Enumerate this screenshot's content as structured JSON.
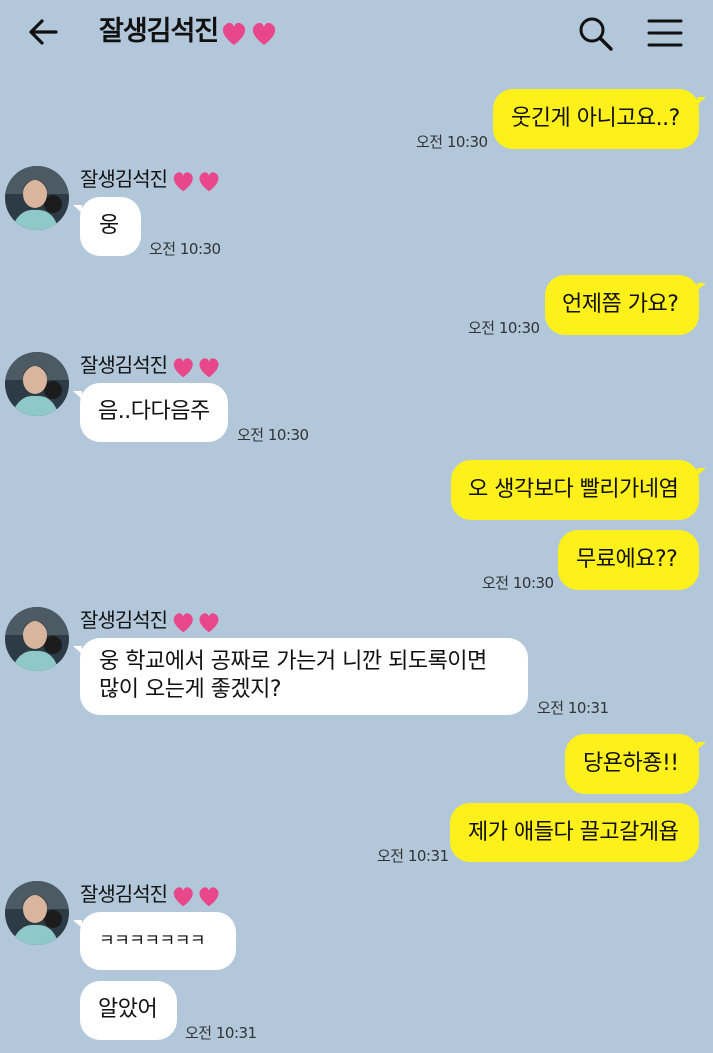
{
  "header": {
    "title": "잘생김석진",
    "accent_heart_color": "#e8488a"
  },
  "contact": {
    "name": "잘생김석진"
  },
  "messages": [
    {
      "from": "me",
      "text": "웃긴게 아니고요..?",
      "time": "오전 10:30"
    },
    {
      "from": "them",
      "text": "웅",
      "time": "오전 10:30"
    },
    {
      "from": "me",
      "text": "언제쯤 가요?",
      "time": "오전 10:30"
    },
    {
      "from": "them",
      "text": "음..다다음주",
      "time": "오전 10:30"
    },
    {
      "from": "me",
      "text": "오 생각보다 빨리가네염"
    },
    {
      "from": "me",
      "text": "무료에요??",
      "time": "오전 10:30"
    },
    {
      "from": "them",
      "line1": "웅 학교에서 공짜로 가는거 니깐 되도록이면",
      "line2": "많이 오는게 좋겠지?",
      "time": "오전 10:31"
    },
    {
      "from": "me",
      "text": "당욘하죵!!"
    },
    {
      "from": "me",
      "text": "제가 애들다 끌고갈게욥",
      "time": "오전 10:31"
    },
    {
      "from": "them",
      "text": "ㅋㅋㅋㅋㅋㅋㅋ"
    },
    {
      "from": "them",
      "text": "알았어",
      "time": "오전 10:31"
    }
  ],
  "colors": {
    "background": "#b2c7da",
    "my_bubble": "#fef01b",
    "their_bubble": "#ffffff"
  }
}
